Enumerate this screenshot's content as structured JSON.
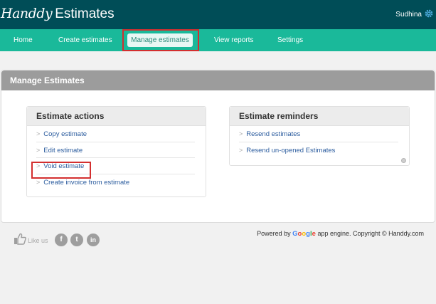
{
  "header": {
    "logo_part1": "Handdy",
    "logo_part2": "Estimates",
    "user_name": "Sudhina",
    "settings_icon": "gear-icon"
  },
  "nav": {
    "items": [
      {
        "label": "Home"
      },
      {
        "label": "Create estimates"
      },
      {
        "label": "Manage estimates",
        "active": true
      },
      {
        "label": "View reports"
      },
      {
        "label": "Settings"
      }
    ]
  },
  "page": {
    "title": "Manage Estimates"
  },
  "estimate_actions": {
    "title": "Estimate actions",
    "items": [
      {
        "label": "Copy estimate"
      },
      {
        "label": "Edit estimate"
      },
      {
        "label": "Void estimate"
      },
      {
        "label": "Create invoice from estimate"
      }
    ]
  },
  "estimate_reminders": {
    "title": "Estimate reminders",
    "items": [
      {
        "label": "Resend estimates"
      },
      {
        "label": "Resend un-opened Estimates"
      }
    ]
  },
  "footer": {
    "like_us": "Like us",
    "social": [
      {
        "icon": "facebook-icon",
        "glyph": "f"
      },
      {
        "icon": "twitter-icon",
        "glyph": "t"
      },
      {
        "icon": "linkedin-icon",
        "glyph": "in"
      }
    ],
    "powered_by": "Powered by",
    "google": "Google",
    "engine_text": "app engine. Copyright © Handdy.com"
  },
  "colors": {
    "header_bg": "#004d57",
    "nav_bg": "#1ab99a",
    "link": "#2b5c9e",
    "highlight": "#d32f2f"
  }
}
